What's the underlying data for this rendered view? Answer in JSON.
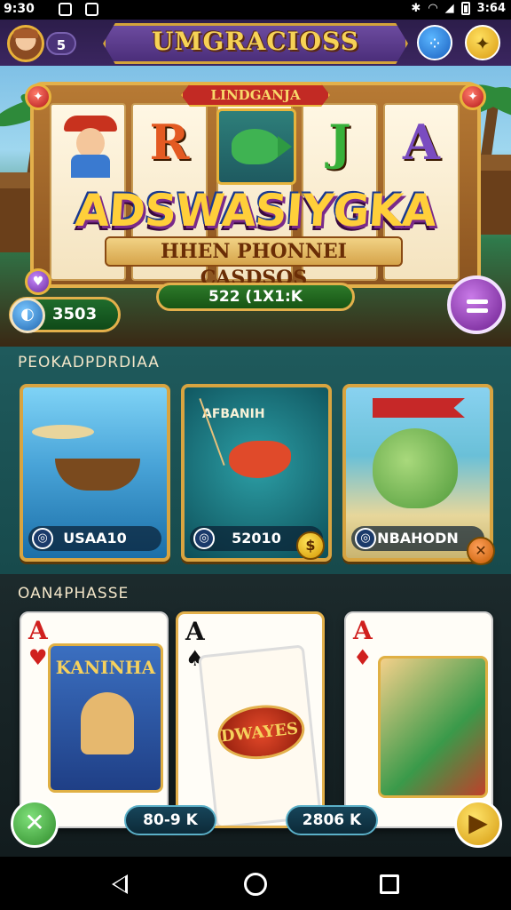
{
  "status_bar": {
    "time": "9:30",
    "right_text": "3:64"
  },
  "header": {
    "title": "UMGRACIOSS",
    "level": "5"
  },
  "hero": {
    "ribbon": "LINDGANJA",
    "reels": [
      "R",
      "J",
      "A"
    ],
    "logo": "ADSWASIYGKA",
    "subtitle": "HHEN PHONNEI CASDSOS",
    "bar_value": "522 (1X1:K",
    "coins": "3503"
  },
  "section1": {
    "title": "PEOKADPDRDIAA",
    "cards": [
      {
        "tag": "",
        "value": "USAA10"
      },
      {
        "tag": "AFBANIH",
        "value": "52010"
      },
      {
        "tag": "",
        "value": "NBAHODN"
      }
    ]
  },
  "section2": {
    "title": "OAN4PHASSE",
    "cards": [
      {
        "corner": "A",
        "inner_title": "KANINHA"
      },
      {
        "corner": "A",
        "inner_title": "DWAYES"
      },
      {
        "corner": "A",
        "inner_title": ""
      }
    ],
    "chip_left": "80-9 K",
    "chip_right": "2806 K"
  },
  "colors": {
    "accent_gold": "#e3b04b",
    "header_purple": "#3b2660",
    "teal_panel": "#1f5a5c"
  },
  "icons": {
    "share": "dots-icon",
    "hint": "lightbulb-icon",
    "menu": "menu-icon",
    "close": "close-icon",
    "play": "play-icon"
  }
}
